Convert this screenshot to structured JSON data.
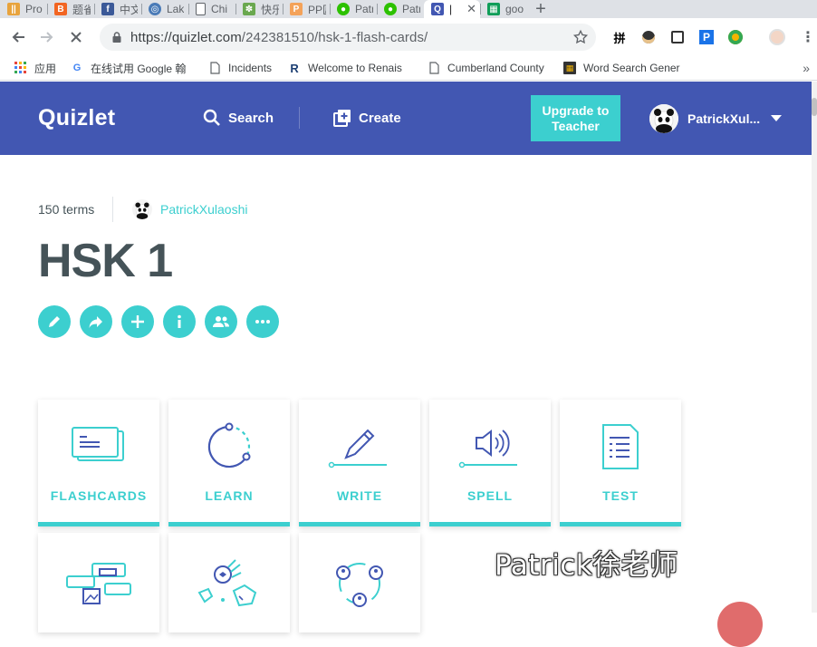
{
  "browser": {
    "tabs": [
      {
        "title": "Pro",
        "icon_color": "#e8a33d",
        "icon_glyph": "||"
      },
      {
        "title": "题雀",
        "icon_color": "#f26522",
        "icon_glyph": "B"
      },
      {
        "title": "中文",
        "icon_color": "#3b5998",
        "icon_glyph": "f"
      },
      {
        "title": "Lak",
        "icon_color": "#4a7bb7",
        "icon_glyph": "◎"
      },
      {
        "title": "Chi",
        "icon_color": "#ffffff",
        "icon_glyph": "▯"
      },
      {
        "title": "快乐",
        "icon_color": "#6aa84f",
        "icon_glyph": "✽"
      },
      {
        "title": "PP匠",
        "icon_color": "#f4a259",
        "icon_glyph": "P"
      },
      {
        "title": "Patr",
        "icon_color": "#2dc100",
        "icon_glyph": "●"
      },
      {
        "title": "Patr",
        "icon_color": "#2dc100",
        "icon_glyph": "●"
      },
      {
        "title": "Q",
        "icon_color": "#4257b2",
        "icon_glyph": "Q",
        "active": true
      },
      {
        "title": "goo",
        "icon_color": "#0f9d58",
        "icon_glyph": "▦"
      }
    ],
    "url": "https://quizlet.com/242381510/hsk-1-flash-cards/",
    "url_base": "https://quizlet.com",
    "url_path": "/242381510/hsk-1-flash-cards/",
    "extensions": [
      "拼",
      "●",
      "□",
      "P",
      "●"
    ],
    "bookmarks": [
      {
        "label": "应用",
        "icon": "apps-grid-icon"
      },
      {
        "label": "在线试用 Google 翰",
        "icon": "google-g-icon"
      },
      {
        "label": "Incidents",
        "icon": "page-icon"
      },
      {
        "label": "Welcome to Renais",
        "icon": "renaissance-r-icon"
      },
      {
        "label": "Cumberland County",
        "icon": "page-icon"
      },
      {
        "label": "Word Search Gener",
        "icon": "puzzle-icon"
      }
    ],
    "bookmarks_more": "»"
  },
  "header": {
    "logo": "Quizlet",
    "search_label": "Search",
    "create_label": "Create",
    "upgrade_line1": "Upgrade to",
    "upgrade_line2": "Teacher",
    "username": "PatrickXul...",
    "brand_color": "#4257b2",
    "accent_color": "#3ccfcf"
  },
  "set": {
    "terms": "150 terms",
    "creator": "PatrickXulaoshi",
    "title": "HSK 1"
  },
  "actions": [
    {
      "name": "edit-icon"
    },
    {
      "name": "share-icon"
    },
    {
      "name": "add-icon"
    },
    {
      "name": "info-icon"
    },
    {
      "name": "group-icon"
    },
    {
      "name": "more-icon"
    }
  ],
  "study_modes": [
    {
      "label": "FLASHCARDS"
    },
    {
      "label": "LEARN"
    },
    {
      "label": "WRITE"
    },
    {
      "label": "SPELL"
    },
    {
      "label": "TEST"
    }
  ],
  "watermark": "Patrick徐老师"
}
